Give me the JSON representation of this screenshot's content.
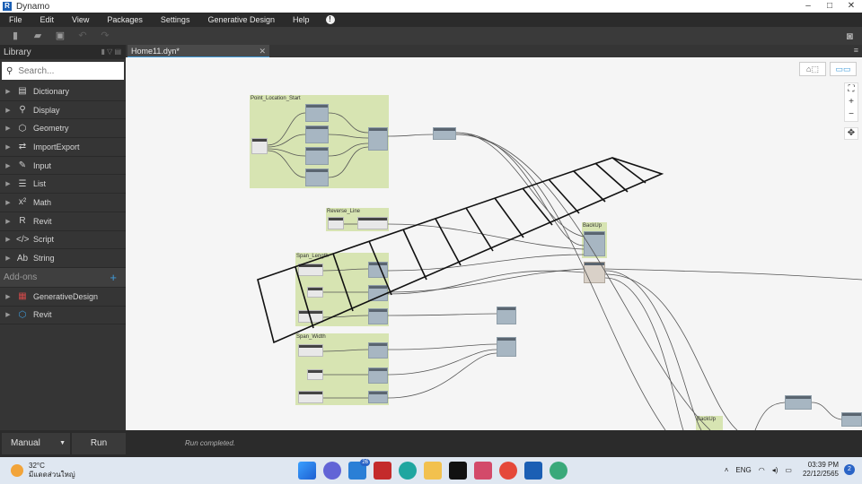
{
  "window": {
    "title": "Dynamo",
    "controls": [
      "–",
      "□",
      "✕"
    ]
  },
  "menubar": {
    "items": [
      "File",
      "Edit",
      "View",
      "Packages",
      "Settings",
      "Generative Design",
      "Help"
    ]
  },
  "library": {
    "header": "Library",
    "search_placeholder": "Search...",
    "categories": [
      {
        "label": "Dictionary",
        "icon": "dictionary-icon"
      },
      {
        "label": "Display",
        "icon": "display-icon"
      },
      {
        "label": "Geometry",
        "icon": "geometry-icon"
      },
      {
        "label": "ImportExport",
        "icon": "import-export-icon"
      },
      {
        "label": "Input",
        "icon": "input-icon"
      },
      {
        "label": "List",
        "icon": "list-icon"
      },
      {
        "label": "Math",
        "icon": "math-icon"
      },
      {
        "label": "Revit",
        "icon": "revit-icon"
      },
      {
        "label": "Script",
        "icon": "script-icon"
      },
      {
        "label": "String",
        "icon": "string-icon"
      }
    ],
    "addons_header": "Add-ons",
    "addons": [
      {
        "label": "GenerativeDesign",
        "icon": "generative-design-icon"
      },
      {
        "label": "Revit",
        "icon": "revit-addon-icon"
      }
    ]
  },
  "tab": {
    "label": "Home11.dyn*"
  },
  "canvas": {
    "groups": [
      {
        "title": "Point_Location_Start"
      },
      {
        "title": "Reverse_Line"
      },
      {
        "title": "Span_Length"
      },
      {
        "title": "Span_Width"
      },
      {
        "title": "BackUp"
      },
      {
        "title": "BackUp"
      }
    ]
  },
  "runbar": {
    "mode": "Manual",
    "run_label": "Run",
    "status": "Run completed."
  },
  "taskbar": {
    "temperature": "32°C",
    "weather_desc": "มีแดดส่วนใหญ่",
    "mail_badge": "26",
    "lang": "ENG",
    "time": "03:39 PM",
    "date": "22/12/2565",
    "notifications": "2"
  }
}
